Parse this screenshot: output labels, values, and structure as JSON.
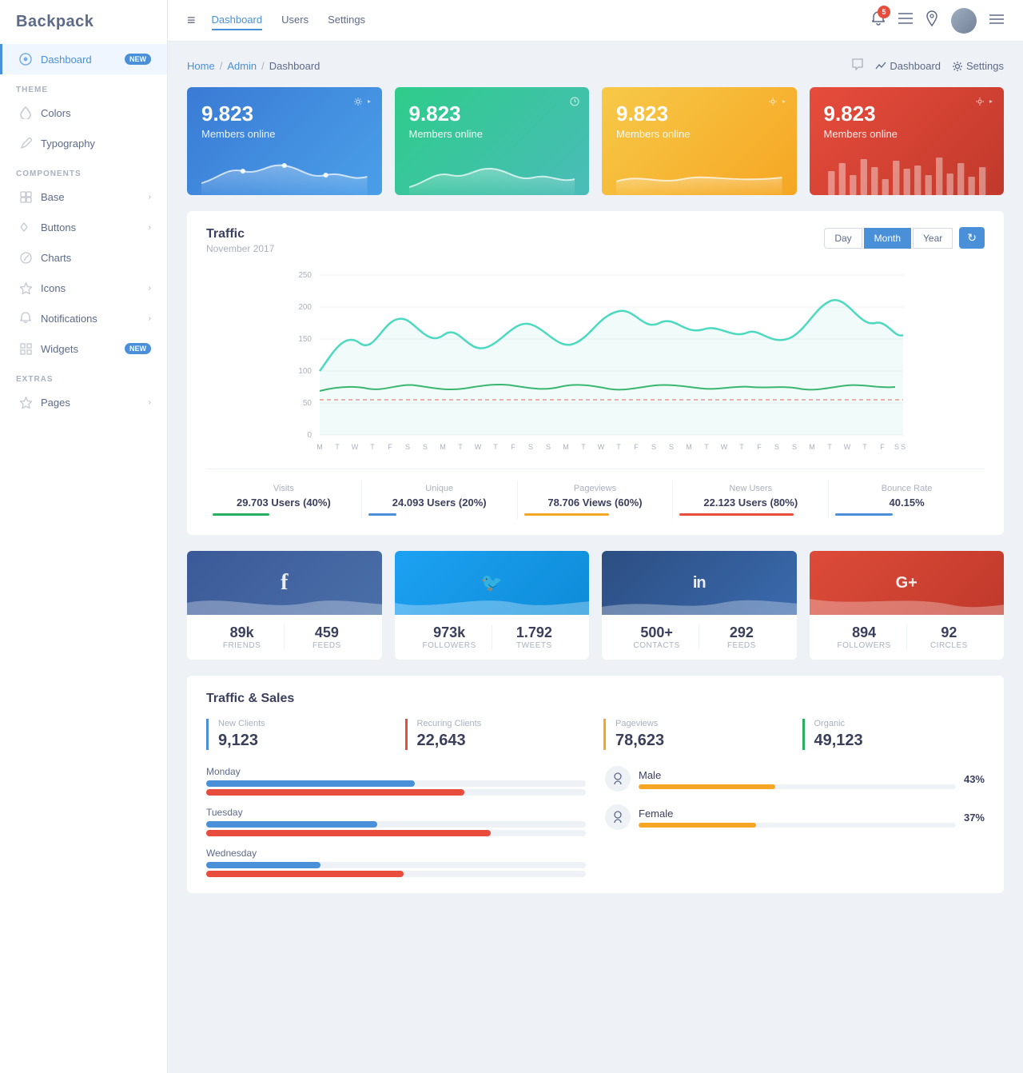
{
  "brand": "Backpack",
  "sidebar": {
    "sections": [
      {
        "title": null,
        "items": [
          {
            "id": "dashboard",
            "label": "Dashboard",
            "icon": "dashboard-icon",
            "active": true,
            "badge": "NEW",
            "arrow": false
          }
        ]
      },
      {
        "title": "THEME",
        "items": [
          {
            "id": "colors",
            "label": "Colors",
            "icon": "droplet-icon",
            "active": false,
            "badge": null,
            "arrow": false
          },
          {
            "id": "typography",
            "label": "Typography",
            "icon": "edit-icon",
            "active": false,
            "badge": null,
            "arrow": false
          }
        ]
      },
      {
        "title": "COMPONENTS",
        "items": [
          {
            "id": "base",
            "label": "Base",
            "icon": "base-icon",
            "active": false,
            "badge": null,
            "arrow": true
          },
          {
            "id": "buttons",
            "label": "Buttons",
            "icon": "arrow-icon",
            "active": false,
            "badge": null,
            "arrow": true
          },
          {
            "id": "charts",
            "label": "Charts",
            "icon": "chart-icon",
            "active": false,
            "badge": null,
            "arrow": false
          },
          {
            "id": "icons",
            "label": "Icons",
            "icon": "star-icon",
            "active": false,
            "badge": null,
            "arrow": true
          },
          {
            "id": "notifications",
            "label": "Notifications",
            "icon": "bell-icon",
            "active": false,
            "badge": null,
            "arrow": true
          },
          {
            "id": "widgets",
            "label": "Widgets",
            "icon": "grid-icon",
            "active": false,
            "badge": "NEW",
            "arrow": false
          }
        ]
      },
      {
        "title": "EXTRAS",
        "items": [
          {
            "id": "pages",
            "label": "Pages",
            "icon": "star-icon",
            "active": false,
            "badge": null,
            "arrow": true
          }
        ]
      }
    ]
  },
  "topbar": {
    "hamburger": "≡",
    "nav_items": [
      {
        "label": "Dashboard",
        "active": true
      },
      {
        "label": "Users",
        "active": false
      },
      {
        "label": "Settings",
        "active": false
      }
    ],
    "notification_count": "5"
  },
  "breadcrumb": {
    "items": [
      "Home",
      "Admin",
      "Dashboard"
    ],
    "actions": [
      {
        "label": "Dashboard",
        "icon": "chart-icon"
      },
      {
        "label": "Settings",
        "icon": "gear-icon"
      }
    ]
  },
  "stat_cards": [
    {
      "number": "9.823",
      "label": "Members online",
      "color": "blue1"
    },
    {
      "number": "9.823",
      "label": "Members online",
      "color": "blue2"
    },
    {
      "number": "9.823",
      "label": "Members online",
      "color": "yellow"
    },
    {
      "number": "9.823",
      "label": "Members online",
      "color": "red"
    }
  ],
  "traffic": {
    "title": "Traffic",
    "subtitle": "November 2017",
    "buttons": [
      "Day",
      "Month",
      "Year"
    ],
    "active_button": "Month",
    "x_labels": [
      "M",
      "T",
      "W",
      "T",
      "F",
      "S",
      "S",
      "M",
      "T",
      "W",
      "T",
      "F",
      "S",
      "S",
      "M",
      "T",
      "W",
      "T",
      "F",
      "S",
      "S",
      "M",
      "T",
      "W",
      "T",
      "F",
      "S",
      "S",
      "M",
      "T",
      "W",
      "T",
      "F",
      "S",
      "S"
    ],
    "y_labels": [
      "250",
      "200",
      "150",
      "100",
      "50",
      "0"
    ],
    "stats": [
      {
        "label": "Visits",
        "value": "29.703 Users (40%)",
        "color": "#27ae60",
        "bar_width": "40%"
      },
      {
        "label": "Unique",
        "value": "24.093 Users (20%)",
        "color": "#4a90d9",
        "bar_width": "20%"
      },
      {
        "label": "Pageviews",
        "value": "78.706 Views (60%)",
        "color": "#f5a623",
        "bar_width": "60%"
      },
      {
        "label": "New Users",
        "value": "22.123 Users (80%)",
        "color": "#e74c3c",
        "bar_width": "80%"
      },
      {
        "label": "Bounce Rate",
        "value": "40.15%",
        "color": "#4a90d9",
        "bar_width": "40%"
      }
    ]
  },
  "social_cards": [
    {
      "platform": "facebook",
      "icon": "f",
      "color": "fb",
      "stats": [
        {
          "num": "89k",
          "label": "FRIENDS"
        },
        {
          "num": "459",
          "label": "FEEDS"
        }
      ]
    },
    {
      "platform": "twitter",
      "icon": "🐦",
      "color": "tw",
      "stats": [
        {
          "num": "973k",
          "label": "FOLLOWERS"
        },
        {
          "num": "1.792",
          "label": "TWEETS"
        }
      ]
    },
    {
      "platform": "linkedin",
      "icon": "in",
      "color": "li",
      "stats": [
        {
          "num": "500+",
          "label": "CONTACTS"
        },
        {
          "num": "292",
          "label": "FEEDS"
        }
      ]
    },
    {
      "platform": "googleplus",
      "icon": "G+",
      "color": "gp",
      "stats": [
        {
          "num": "894",
          "label": "FOLLOWERS"
        },
        {
          "num": "92",
          "label": "CIRCLES"
        }
      ]
    }
  ],
  "traffic_sales": {
    "title": "Traffic & Sales",
    "stats": [
      {
        "label": "New Clients",
        "value": "9,123",
        "color_class": "ts-stat-blue"
      },
      {
        "label": "Recuring Clients",
        "value": "22,643",
        "color_class": "ts-stat-red"
      },
      {
        "label": "Pageviews",
        "value": "78,623",
        "color_class": "ts-stat-yellow"
      },
      {
        "label": "Organic",
        "value": "49,123",
        "color_class": "ts-stat-green"
      }
    ],
    "bar_rows": [
      {
        "label": "Monday",
        "bars": [
          {
            "width": "55%",
            "color": "ts-bar-blue"
          },
          {
            "width": "68%",
            "color": "ts-bar-red"
          }
        ]
      },
      {
        "label": "Tuesday",
        "bars": [
          {
            "width": "45%",
            "color": "ts-bar-blue"
          },
          {
            "width": "75%",
            "color": "ts-bar-red"
          }
        ]
      },
      {
        "label": "Wednesday",
        "bars": [
          {
            "width": "30%",
            "color": "ts-bar-blue"
          },
          {
            "width": "52%",
            "color": "ts-bar-red"
          }
        ]
      }
    ],
    "gender": [
      {
        "name": "Male",
        "pct": "43%",
        "bar_width": "43%",
        "bar_color": "#f5a623"
      },
      {
        "name": "Female",
        "pct": "37%",
        "bar_width": "37%",
        "bar_color": "#f5a623"
      }
    ]
  }
}
